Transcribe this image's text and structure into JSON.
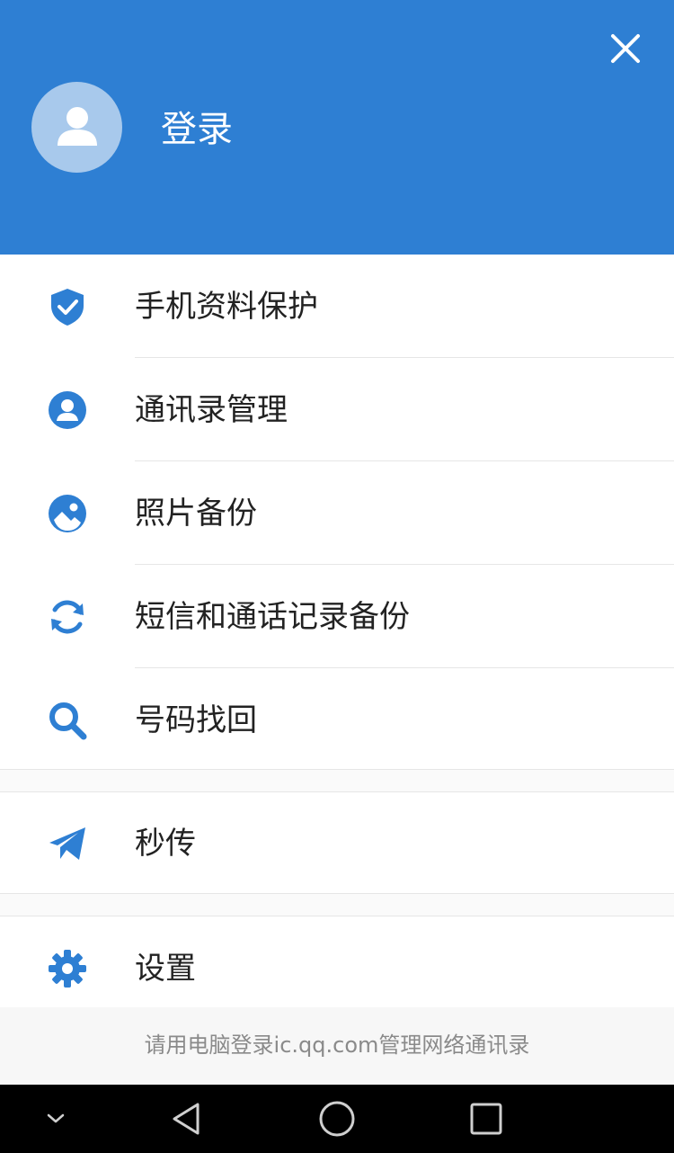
{
  "header": {
    "login_label": "登录",
    "close_icon": "close-icon",
    "avatar_icon": "person-icon",
    "background": "#2e7fd3"
  },
  "menu": {
    "accent_color": "#2e7fd3",
    "group1": [
      {
        "icon": "shield-check-icon",
        "label": "手机资料保护"
      },
      {
        "icon": "contact-icon",
        "label": "通讯录管理"
      },
      {
        "icon": "photo-icon",
        "label": "照片备份"
      },
      {
        "icon": "sync-icon",
        "label": "短信和通话记录备份"
      },
      {
        "icon": "search-icon",
        "label": "号码找回"
      }
    ],
    "group2": [
      {
        "icon": "paper-plane-icon",
        "label": "秒传"
      }
    ],
    "group3": [
      {
        "icon": "gear-icon",
        "label": "设置"
      }
    ]
  },
  "footer_note": "请用电脑登录ic.qq.com管理网络通讯录",
  "navbar": {
    "buttons": [
      "chevron-down-icon",
      "back-icon",
      "home-icon",
      "recents-icon"
    ]
  }
}
